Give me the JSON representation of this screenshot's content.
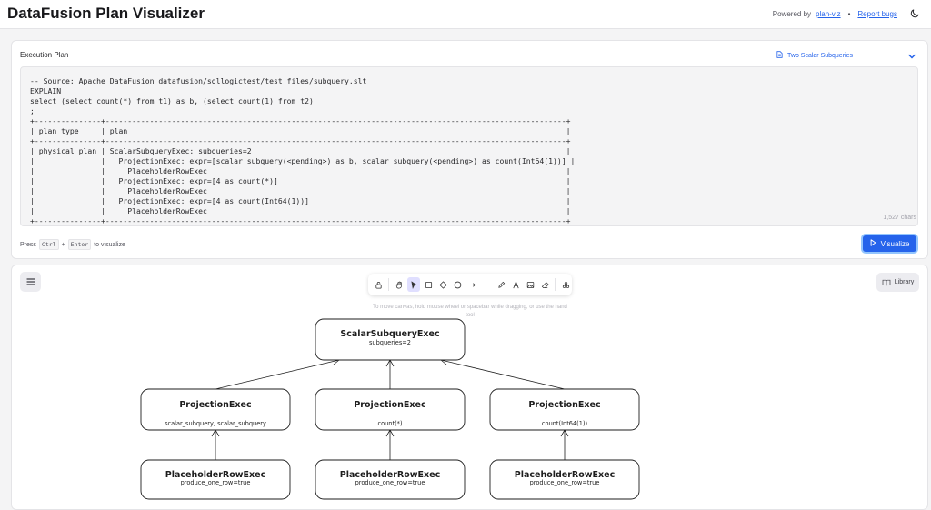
{
  "app": {
    "title": "DataFusion Plan Visualizer",
    "powered_by": "Powered by",
    "plan_viz_link": "plan-viz",
    "separator": "•",
    "report_bugs": "Report bugs"
  },
  "editor": {
    "label": "Execution Plan",
    "preset": "Two Scalar Subqueries",
    "code": "-- Source: Apache DataFusion datafusion/sqllogictest/test_files/subquery.slt\nEXPLAIN\nselect (select count(*) from t1) as b, (select count(1) from t2)\n;\n+---------------+--------------------------------------------------------------------------------------------------------+\n| plan_type     | plan                                                                                                   |\n+---------------+--------------------------------------------------------------------------------------------------------+\n| physical_plan | ScalarSubqueryExec: subqueries=2                                                                       |\n|               |   ProjectionExec: expr=[scalar_subquery(<pending>) as b, scalar_subquery(<pending>) as count(Int64(1))] |\n|               |     PlaceholderRowExec                                                                                 |\n|               |   ProjectionExec: expr=[4 as count(*)]                                                                 |\n|               |     PlaceholderRowExec                                                                                 |\n|               |   ProjectionExec: expr=[4 as count(Int64(1))]                                                          |\n|               |     PlaceholderRowExec                                                                                 |\n+---------------+--------------------------------------------------------------------------------------------------------+",
    "char_count": "1,527 chars",
    "hint_press": "Press",
    "hint_key1": "Ctrl",
    "hint_plus": "+",
    "hint_key2": "Enter",
    "hint_suffix": "to visualize",
    "visualize_label": "Visualize"
  },
  "canvas": {
    "library_label": "Library",
    "hint": "To move canvas, hold mouse wheel or spacebar while dragging, or use the hand tool",
    "tools": [
      "lock-icon",
      "hand-icon",
      "selection-icon",
      "rectangle-icon",
      "diamond-icon",
      "ellipse-icon",
      "arrow-icon",
      "line-icon",
      "pencil-icon",
      "text-icon",
      "image-icon",
      "eraser-icon",
      "extra-tools-icon"
    ],
    "nodes": [
      {
        "title": "ScalarSubqueryExec",
        "detail": "subqueries=2"
      },
      {
        "title": "ProjectionExec",
        "detail": "scalar_subquery, scalar_subquery"
      },
      {
        "title": "ProjectionExec",
        "detail": "count(*)"
      },
      {
        "title": "ProjectionExec",
        "detail": "count(Int64(1))"
      },
      {
        "title": "PlaceholderRowExec",
        "detail": "produce_one_row=true"
      },
      {
        "title": "PlaceholderRowExec",
        "detail": "produce_one_row=true"
      },
      {
        "title": "PlaceholderRowExec",
        "detail": "produce_one_row=true"
      }
    ]
  },
  "colors": {
    "accent": "#2563eb",
    "tool_active": "#e0dfff"
  }
}
